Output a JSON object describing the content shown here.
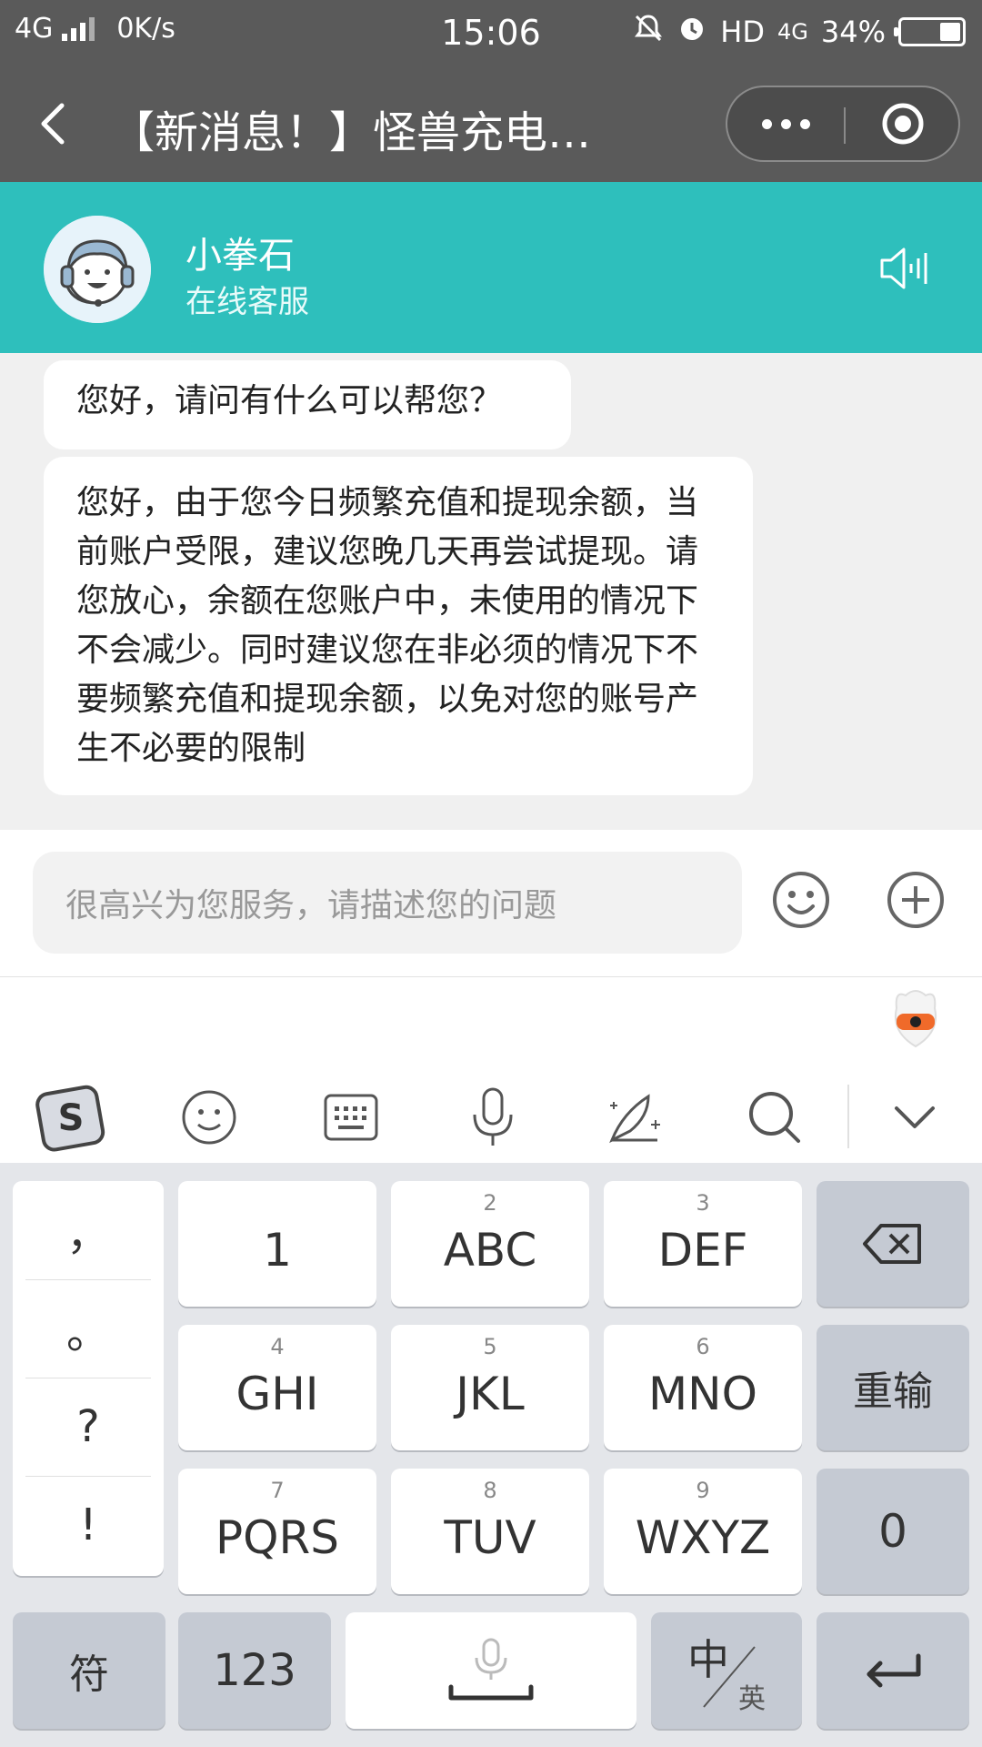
{
  "status_bar": {
    "network": "4G",
    "speed": "0K/s",
    "time": "15:06",
    "hd": "HD",
    "network2": "4G",
    "battery": "34%"
  },
  "title_bar": {
    "title": "【新消息！】怪兽充电…"
  },
  "agent": {
    "name": "小拳石",
    "role": "在线客服"
  },
  "messages": [
    {
      "text": "您好，请问有什么可以帮您？"
    },
    {
      "text": "您好，由于您今日频繁充值和提现余额，当前账户受限，建议您晚几天再尝试提现。请您放心，余额在您账户中，未使用的情况下不会减少。同时建议您在非必须的情况下不要频繁充值和提现余额，以免对您的账号产生不必要的限制"
    }
  ],
  "input": {
    "placeholder": "很高兴为您服务，请描述您的问题"
  },
  "keyboard": {
    "punctuation": [
      "，",
      "。",
      "?",
      "!"
    ],
    "rows": [
      [
        {
          "sub": "",
          "main": "1"
        },
        {
          "sub": "2",
          "main": "ABC"
        },
        {
          "sub": "3",
          "main": "DEF"
        }
      ],
      [
        {
          "sub": "4",
          "main": "GHI"
        },
        {
          "sub": "5",
          "main": "JKL"
        },
        {
          "sub": "6",
          "main": "MNO"
        }
      ],
      [
        {
          "sub": "7",
          "main": "PQRS"
        },
        {
          "sub": "8",
          "main": "TUV"
        },
        {
          "sub": "9",
          "main": "WXYZ"
        }
      ]
    ],
    "reenter": "重输",
    "zero": "0",
    "symbols": "符",
    "numbers": "123",
    "lang_main": "中",
    "lang_sub": "英"
  },
  "colors": {
    "header_bg": "#2ebfbc",
    "title_bg": "#5a5a5a",
    "chat_bg": "#f0f0f0",
    "keyboard_bg": "#e4e6ea"
  }
}
